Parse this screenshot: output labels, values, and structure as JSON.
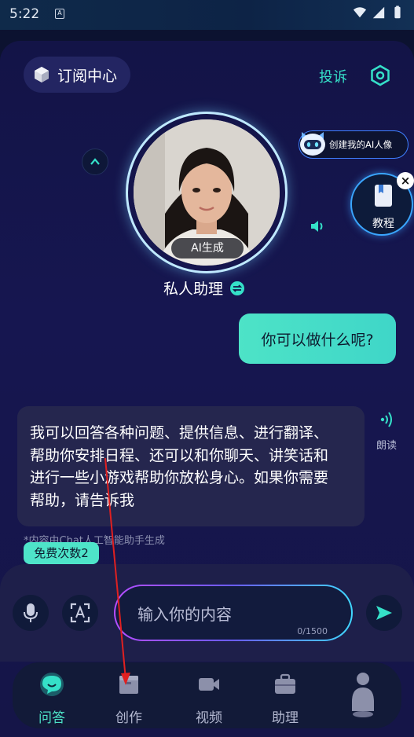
{
  "status_bar": {
    "time": "5:22",
    "badge": "A"
  },
  "header": {
    "subscribe_label": "订阅中心",
    "complain_label": "投诉"
  },
  "assistant": {
    "ai_tag": "AI生成",
    "name": "私人助理"
  },
  "create_ai": {
    "label": "创建我的AI人像"
  },
  "tutorial": {
    "label": "教程"
  },
  "chat": {
    "user_message": "你可以做什么呢?",
    "bot_lines": [
      "我可以回答各种问题、提供信息、进行翻译、",
      "帮助你安排日程、还可以和你聊天、讲笑话和",
      "进行一些小游戏帮助你放松身心。如果你需要",
      "帮助，请告诉我"
    ],
    "read_label": "朗读",
    "disclaimer": "*内容由Chat人工智能助手生成",
    "free_badge": "免费次数2"
  },
  "input": {
    "placeholder": "输入你的内容",
    "counter": "0/1500"
  },
  "nav": {
    "items": [
      {
        "label": "问答",
        "icon": "chat-bubble-icon",
        "active": true
      },
      {
        "label": "创作",
        "icon": "box-icon",
        "active": false
      },
      {
        "label": "视频",
        "icon": "video-camera-icon",
        "active": false
      },
      {
        "label": "助理",
        "icon": "briefcase-icon",
        "active": false
      },
      {
        "label": "",
        "icon": "person-icon",
        "active": false
      }
    ]
  },
  "colors": {
    "accent": "#4de3c7",
    "panel": "#141449",
    "bubble_bot": "#25264e",
    "annotation": "#e02020"
  }
}
